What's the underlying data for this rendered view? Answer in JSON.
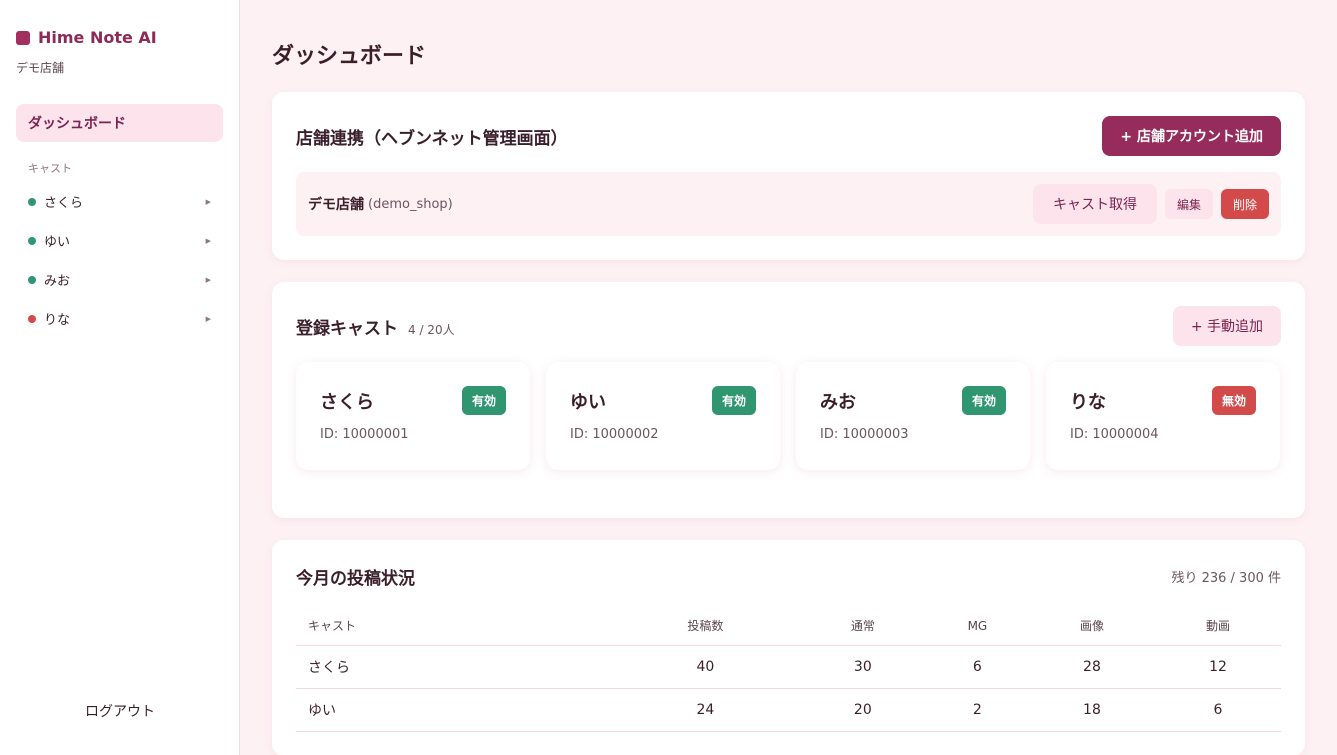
{
  "brand": {
    "name": "Hime Note AI",
    "shop": "デモ店舗"
  },
  "sidebar": {
    "dashboard_label": "ダッシュボード",
    "cast_section_label": "キャスト",
    "casts": [
      {
        "name": "さくら",
        "active": true
      },
      {
        "name": "ゆい",
        "active": true
      },
      {
        "name": "みお",
        "active": true
      },
      {
        "name": "りな",
        "active": false
      }
    ],
    "logout_label": "ログアウト"
  },
  "main": {
    "title": "ダッシュボード",
    "shop_link": {
      "title": "店舗連携（ヘブンネット管理画面）",
      "add_button": "+ 店舗アカウント追加",
      "shop_name": "デモ店舗",
      "shop_id": "(demo_shop)",
      "fetch_button": "キャスト取得",
      "edit_button": "編集",
      "delete_button": "削除"
    },
    "casts_panel": {
      "title": "登録キャスト",
      "count": "4 / 20人",
      "add_button": "+ 手動追加",
      "cards": [
        {
          "name": "さくら",
          "status": "有効",
          "id": "ID: 10000001",
          "active": true
        },
        {
          "name": "ゆい",
          "status": "有効",
          "id": "ID: 10000002",
          "active": true
        },
        {
          "name": "みお",
          "status": "有効",
          "id": "ID: 10000003",
          "active": true
        },
        {
          "name": "りな",
          "status": "無効",
          "id": "ID: 10000004",
          "active": false
        }
      ]
    },
    "posts_panel": {
      "title": "今月の投稿状況",
      "remaining": "残り 236 / 300 件",
      "headers": [
        "キャスト",
        "投稿数",
        "通常",
        "MG",
        "画像",
        "動画"
      ],
      "rows": [
        [
          "さくら",
          "40",
          "30",
          "6",
          "28",
          "12"
        ],
        [
          "ゆい",
          "24",
          "20",
          "2",
          "18",
          "6"
        ]
      ]
    }
  },
  "colors": {
    "accent": "#952c5c",
    "active": "#2f9670",
    "inactive": "#d24a4a",
    "background": "#fdf1f4"
  }
}
